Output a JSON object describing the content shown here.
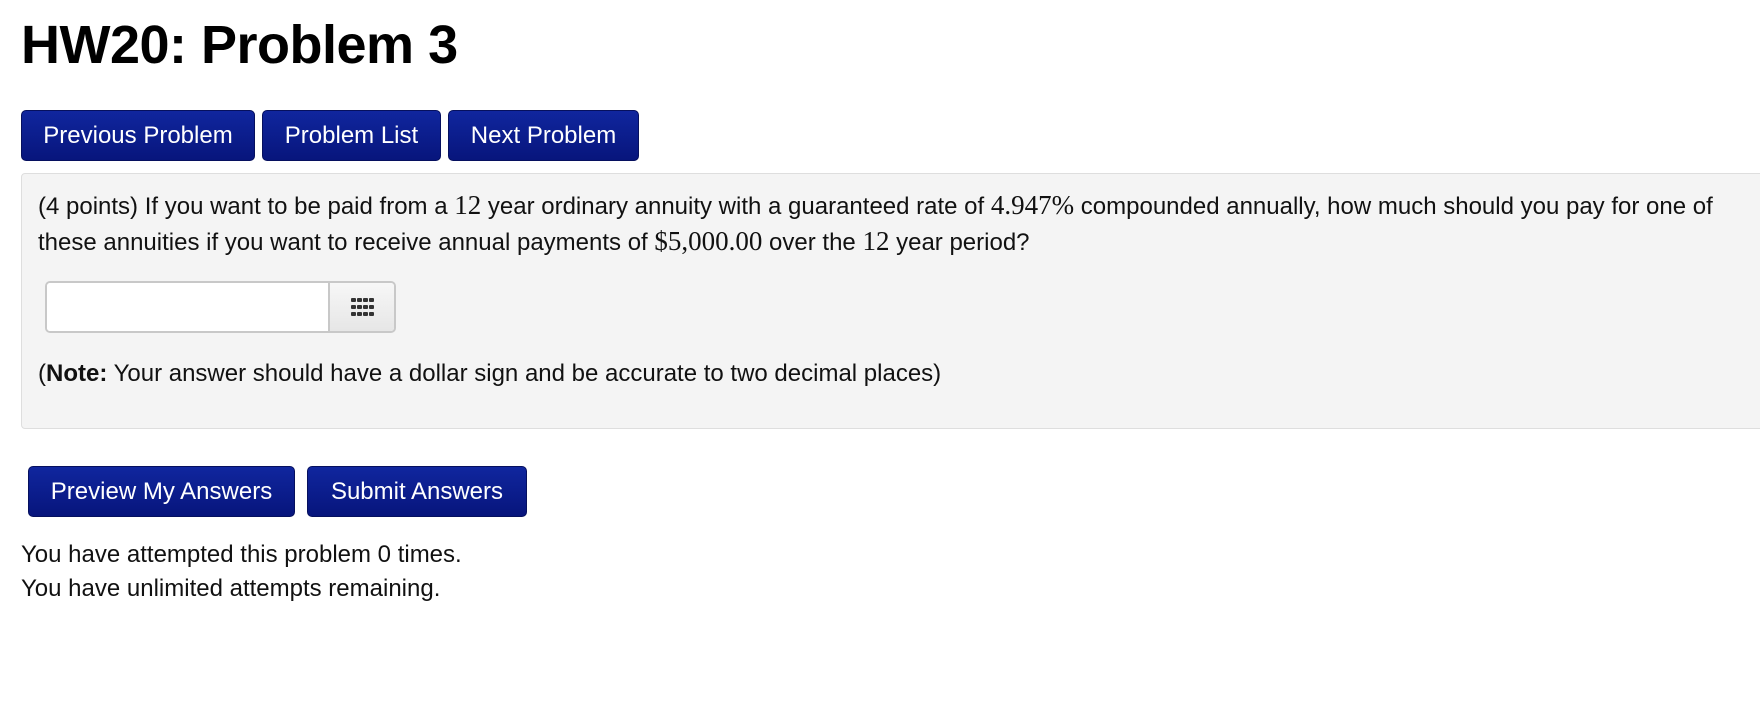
{
  "page": {
    "title": "HW20: Problem 3"
  },
  "nav": {
    "previous_label": "Previous Problem",
    "list_label": "Problem List",
    "next_label": "Next Problem"
  },
  "problem": {
    "text_1": "(4 points) If you want to be paid from a ",
    "years": "12",
    "text_2": " year ordinary annuity with a guaranteed rate of ",
    "rate": "4.947%",
    "text_3": " compounded annually, how much should you pay for one of these annuities if you want to receive annual payments of ",
    "payment": "$5,000.00",
    "text_4": " over the ",
    "years_again": "12",
    "text_5": " year period?"
  },
  "answer": {
    "value": "",
    "placeholder": "",
    "keypad_icon": "keypad-grid-icon"
  },
  "note": {
    "open_paren": "(",
    "label": "Note:",
    "text": " Your answer should have a dollar sign and be accurate to two decimal places)"
  },
  "actions": {
    "preview_label": "Preview My Answers",
    "submit_label": "Submit Answers"
  },
  "status": {
    "attempts": "You have attempted this problem 0 times.",
    "remaining": "You have unlimited attempts remaining."
  },
  "colors": {
    "button_bg": "#0c1c8e",
    "button_text": "#ffffff",
    "problem_bg": "#f4f4f4"
  }
}
